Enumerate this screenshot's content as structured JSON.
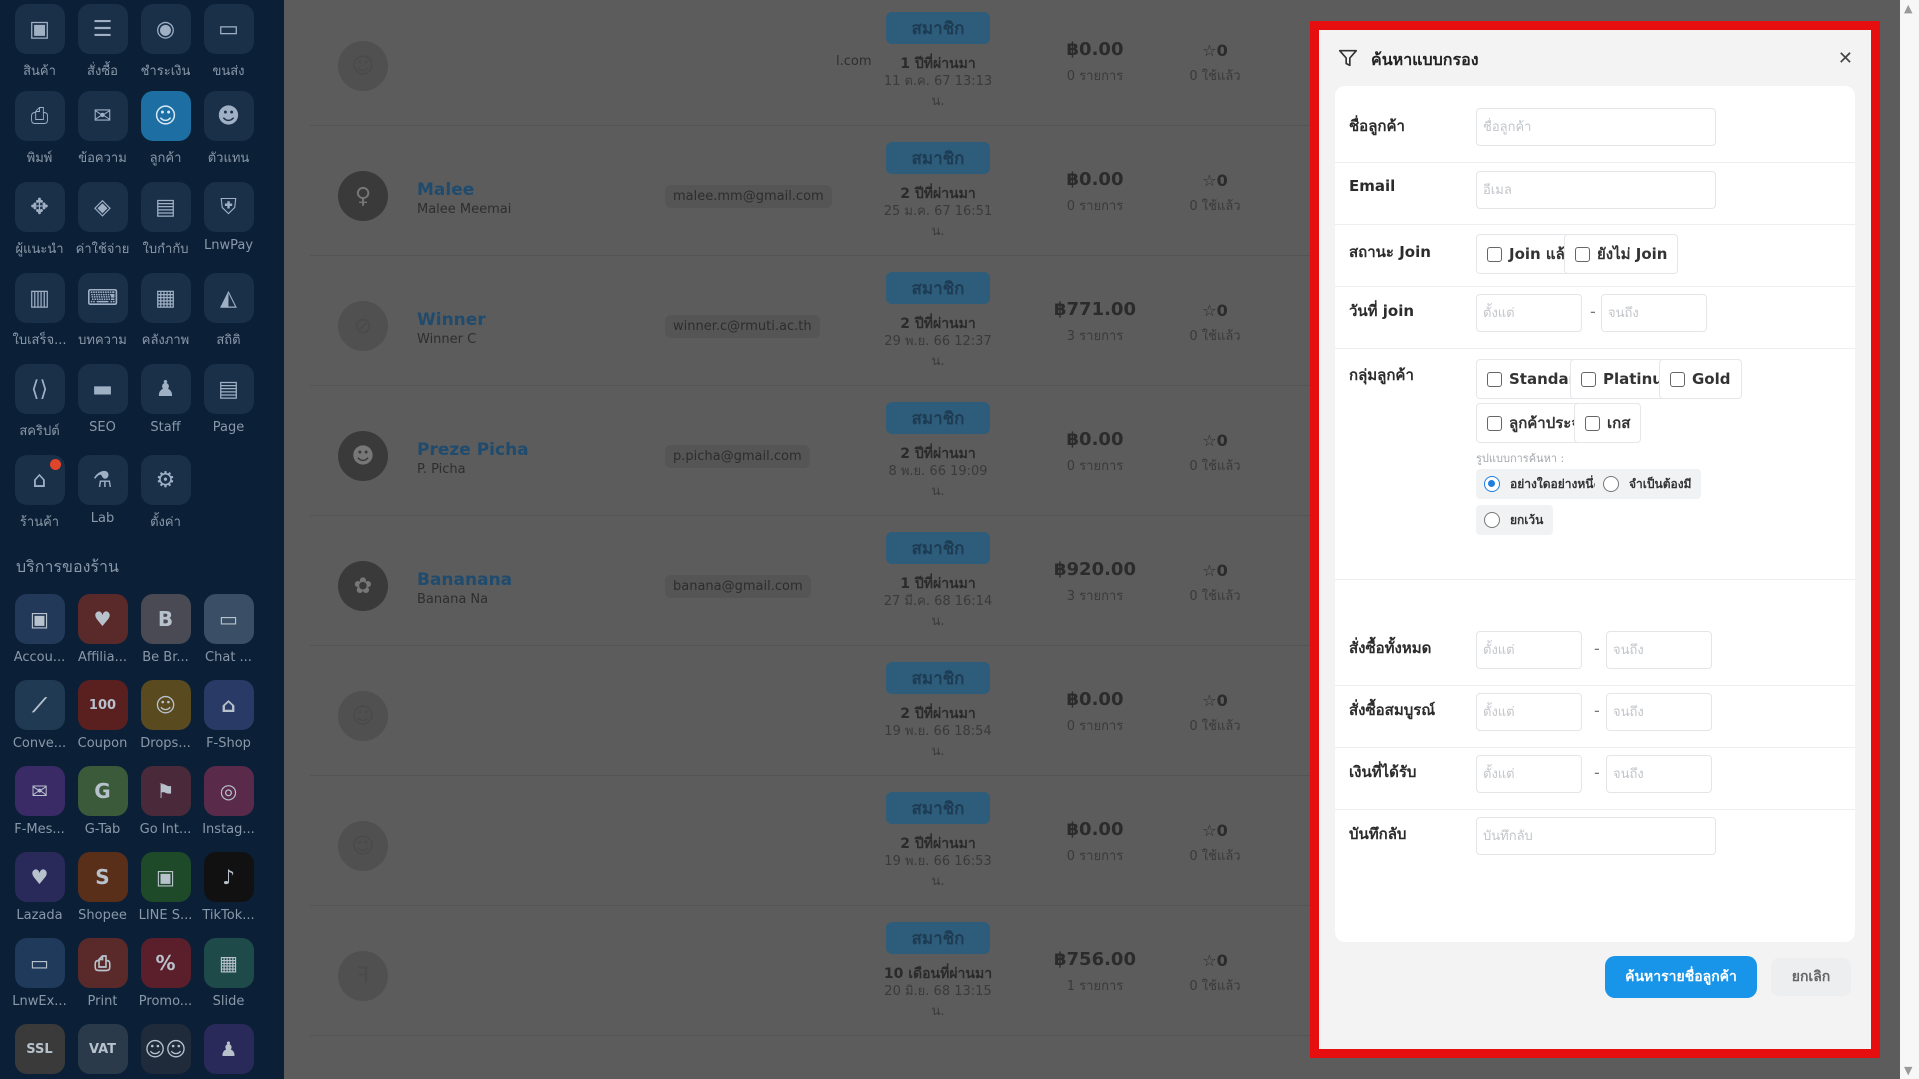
{
  "sidebar": {
    "apps": [
      {
        "label": "สินค้า",
        "icon": "product-box-icon",
        "glyph": "▣"
      },
      {
        "label": "สั่งซื้อ",
        "icon": "order-list-icon",
        "glyph": "☰"
      },
      {
        "label": "ชำระเงิน",
        "icon": "payment-piggy-icon",
        "glyph": "◉"
      },
      {
        "label": "ขนส่ง",
        "icon": "delivery-truck-icon",
        "glyph": "▭"
      },
      {
        "label": "พิมพ์",
        "icon": "printer-icon",
        "glyph": "⎙"
      },
      {
        "label": "ข้อความ",
        "icon": "mailbox-icon",
        "glyph": "✉"
      },
      {
        "label": "ลูกค้า",
        "icon": "customer-icon",
        "glyph": "☺",
        "active": true
      },
      {
        "label": "ตัวแทน",
        "icon": "agent-icon",
        "glyph": "☻"
      },
      {
        "label": "ผู้แนะนำ",
        "icon": "referrer-icon",
        "glyph": "✥"
      },
      {
        "label": "ค่าใช้จ่าย",
        "icon": "expense-bag-icon",
        "glyph": "◈"
      },
      {
        "label": "ใบกำกับ",
        "icon": "invoice-icon",
        "glyph": "▤"
      },
      {
        "label": "LnwPay",
        "icon": "shield-pay-icon",
        "glyph": "⛨"
      },
      {
        "label": "ใบเสร็จ...",
        "icon": "receipt-icon",
        "glyph": "▥"
      },
      {
        "label": "บทความ",
        "icon": "article-keyboard-icon",
        "glyph": "⌨"
      },
      {
        "label": "คลังภาพ",
        "icon": "image-gallery-icon",
        "glyph": "▦"
      },
      {
        "label": "สถิติ",
        "icon": "stats-chart-icon",
        "glyph": "◭"
      },
      {
        "label": "สคริปต์",
        "icon": "script-code-icon",
        "glyph": "⟨⟩"
      },
      {
        "label": "SEO",
        "icon": "seo-icon",
        "glyph": "▬"
      },
      {
        "label": "Staff",
        "icon": "staff-icon",
        "glyph": "♟"
      },
      {
        "label": "Page",
        "icon": "page-icon",
        "glyph": "▤"
      },
      {
        "label": "ร้านค้า",
        "icon": "shop-icon",
        "glyph": "⌂",
        "dot": true
      },
      {
        "label": "Lab",
        "icon": "lab-flask-icon",
        "glyph": "⚗"
      },
      {
        "label": "ตั้งค่า",
        "icon": "settings-gear-icon",
        "glyph": "⚙"
      }
    ],
    "services_title": "บริการของร้าน",
    "services": [
      {
        "label": "Accou...",
        "icon": "account-icon",
        "glyph": "▣",
        "color": "#23395a"
      },
      {
        "label": "Affilia...",
        "icon": "affiliate-icon",
        "glyph": "♥",
        "color": "#5a2a2a"
      },
      {
        "label": "Be Br...",
        "icon": "be-brand-icon",
        "glyph": "B",
        "color": "#4a4a55"
      },
      {
        "label": "Chat ...",
        "icon": "chat-icon",
        "glyph": "▭",
        "color": "#3a4f66"
      },
      {
        "label": "Conve...",
        "icon": "conversion-icon",
        "glyph": "⟋",
        "color": "#1f3a52"
      },
      {
        "label": "Coupon",
        "icon": "coupon-icon",
        "glyph": "100",
        "color": "#5a1f1f"
      },
      {
        "label": "Drops...",
        "icon": "dropship-icon",
        "glyph": "☺",
        "color": "#5a4a1f"
      },
      {
        "label": "F-Shop",
        "icon": "f-shop-icon",
        "glyph": "⌂",
        "color": "#2a3a66"
      },
      {
        "label": "F-Mes...",
        "icon": "messenger-icon",
        "glyph": "✉",
        "color": "#3a2a66"
      },
      {
        "label": "G-Tab",
        "icon": "g-tab-icon",
        "glyph": "G",
        "color": "#3a5a3a"
      },
      {
        "label": "Go Int...",
        "icon": "go-inter-icon",
        "glyph": "⚑",
        "color": "#4a2a3a"
      },
      {
        "label": "Instag...",
        "icon": "instagram-icon",
        "glyph": "◎",
        "color": "#5a2a4a"
      },
      {
        "label": "Lazada",
        "icon": "lazada-icon",
        "glyph": "♥",
        "color": "#2a2a5a"
      },
      {
        "label": "Shopee",
        "icon": "shopee-icon",
        "glyph": "S",
        "color": "#5a2f1a"
      },
      {
        "label": "LINE S...",
        "icon": "line-shop-icon",
        "glyph": "▣",
        "color": "#1f4a2a"
      },
      {
        "label": "TikTok...",
        "icon": "tiktok-icon",
        "glyph": "♪",
        "color": "#111111"
      },
      {
        "label": "LnwEx...",
        "icon": "lnw-express-icon",
        "glyph": "▭",
        "color": "#1f3a5a"
      },
      {
        "label": "Print",
        "icon": "print-service-icon",
        "glyph": "⎙",
        "color": "#5a2a2a"
      },
      {
        "label": "Promo...",
        "icon": "promotion-icon",
        "glyph": "%",
        "color": "#5a1f2a"
      },
      {
        "label": "Slide",
        "icon": "slide-icon",
        "glyph": "▦",
        "color": "#1f4a4a"
      },
      {
        "label": "SSL",
        "icon": "ssl-icon",
        "glyph": "SSL",
        "color": "#3a3a3a"
      },
      {
        "label": "",
        "icon": "vat-icon",
        "glyph": "VAT",
        "color": "#2a3a4a"
      },
      {
        "label": "",
        "icon": "team-icon",
        "glyph": "☺☺",
        "color": "#1f2a3a"
      },
      {
        "label": "",
        "icon": "staff-service-icon",
        "glyph": "♟",
        "color": "#2a2a5a"
      }
    ]
  },
  "customers": [
    {
      "name": "",
      "username": "",
      "email": "",
      "email_tail": "l.com",
      "badge": "สมาชิก",
      "relative": "1 ปีที่ผ่านมา",
      "date": "11 ต.ค. 67 13:13",
      "date_tail": "น.",
      "amount": "฿0.00",
      "orders": "0 รายการ",
      "points": "☆0",
      "used": "0 ใช้แล้ว",
      "avatar_glyph": "☺",
      "photo": false
    },
    {
      "name": "Malee",
      "username": "Malee Meemai",
      "email": "malee.mm@gmail.com",
      "email_tail": "",
      "badge": "สมาชิก",
      "relative": "2 ปีที่ผ่านมา",
      "date": "25 ม.ค. 67 16:51",
      "date_tail": "น.",
      "amount": "฿0.00",
      "orders": "0 รายการ",
      "points": "☆0",
      "used": "0 ใช้แล้ว",
      "avatar_glyph": "♀",
      "photo": true
    },
    {
      "name": "Winner",
      "username": "Winner C",
      "email": "winner.c@rmuti.ac.th",
      "email_tail": "",
      "badge": "สมาชิก",
      "relative": "2 ปีที่ผ่านมา",
      "date": "29 พ.ย. 66 12:37",
      "date_tail": "น.",
      "amount": "฿771.00",
      "orders": "3 รายการ",
      "points": "☆0",
      "used": "0 ใช้แล้ว",
      "avatar_glyph": "⊘",
      "photo": false
    },
    {
      "name": "Preze Picha",
      "username": "P. Picha",
      "email": "p.picha@gmail.com",
      "email_tail": "",
      "badge": "สมาชิก",
      "relative": "2 ปีที่ผ่านมา",
      "date": "8 พ.ย. 66 19:09",
      "date_tail": "น.",
      "amount": "฿0.00",
      "orders": "0 รายการ",
      "points": "☆0",
      "used": "0 ใช้แล้ว",
      "avatar_glyph": "☻",
      "photo": true
    },
    {
      "name": "Bananana",
      "username": "Banana Na",
      "email": "banana@gmail.com",
      "email_tail": "",
      "badge": "สมาชิก",
      "relative": "1 ปีที่ผ่านมา",
      "date": "27 มี.ค. 68 16:14",
      "date_tail": "น.",
      "amount": "฿920.00",
      "orders": "3 รายการ",
      "points": "☆0",
      "used": "0 ใช้แล้ว",
      "avatar_glyph": "✿",
      "photo": true
    },
    {
      "name": "",
      "username": "",
      "email": "",
      "email_tail": "",
      "badge": "สมาชิก",
      "relative": "2 ปีที่ผ่านมา",
      "date": "19 พ.ย. 66 18:54",
      "date_tail": "น.",
      "amount": "฿0.00",
      "orders": "0 รายการ",
      "points": "☆0",
      "used": "0 ใช้แล้ว",
      "avatar_glyph": "☺",
      "photo": false
    },
    {
      "name": "",
      "username": "",
      "email": "",
      "email_tail": "",
      "badge": "สมาชิก",
      "relative": "2 ปีที่ผ่านมา",
      "date": "19 พ.ย. 66 16:53",
      "date_tail": "น.",
      "amount": "฿0.00",
      "orders": "0 รายการ",
      "points": "☆0",
      "used": "0 ใช้แล้ว",
      "avatar_glyph": "☺",
      "photo": false
    },
    {
      "name": "",
      "username": "",
      "email": "",
      "email_tail": "",
      "badge": "สมาชิก",
      "relative": "10 เดือนที่ผ่านมา",
      "date": "20 มิ.ย. 68 13:15",
      "date_tail": "น.",
      "amount": "฿756.00",
      "orders": "1 รายการ",
      "points": "☆0",
      "used": "0 ใช้แล้ว",
      "avatar_glyph": "ꟻ",
      "photo": false
    }
  ],
  "filter": {
    "title": "ค้นหาแบบกรอง",
    "close": "✕",
    "customer_name": {
      "label": "ชื่อลูกค้า",
      "placeholder": "ชื่อลูกค้า",
      "value": ""
    },
    "email": {
      "label": "Email",
      "placeholder": "อีเมล",
      "value": ""
    },
    "join_status": {
      "label": "สถานะ Join",
      "options": [
        {
          "label": "Join แล้ว",
          "checked": false
        },
        {
          "label": "ยังไม่ Join",
          "checked": false
        }
      ]
    },
    "join_date": {
      "label": "วันที่ join",
      "from_placeholder": "ตั้งแต่",
      "to_placeholder": "จนถึง",
      "sep": "-"
    },
    "group": {
      "label": "กลุ่มลูกค้า",
      "options": [
        {
          "label": "Standard",
          "checked": false
        },
        {
          "label": "Platinum",
          "checked": false
        },
        {
          "label": "Gold",
          "checked": false
        },
        {
          "label": "ลูกค้าประจำ",
          "checked": false
        },
        {
          "label": "เกส",
          "checked": false
        }
      ],
      "mode_label": "รูปแบบการค้นหา :",
      "modes": [
        {
          "label": "อย่างใดอย่างหนึ่ง",
          "selected": true
        },
        {
          "label": "จำเป็นต้องมี",
          "selected": false
        },
        {
          "label": "ยกเว้น",
          "selected": false
        }
      ]
    },
    "total_orders": {
      "label": "สั่งซื้อทั้งหมด",
      "from_placeholder": "ตั้งแต่",
      "to_placeholder": "จนถึง",
      "sep": "-"
    },
    "completed_orders": {
      "label": "สั่งซื้อสมบูรณ์",
      "from_placeholder": "ตั้งแต่",
      "to_placeholder": "จนถึง",
      "sep": "-"
    },
    "money_received": {
      "label": "เงินที่ได้รับ",
      "from_placeholder": "ตั้งแต่",
      "to_placeholder": "จนถึง",
      "sep": "-"
    },
    "note": {
      "label": "บันทึกลับ",
      "placeholder": "บันทึกลับ",
      "value": ""
    },
    "search_button": "ค้นหารายชื่อลูกค้า",
    "cancel_button": "ยกเลิก"
  },
  "scrollbar": {
    "up": "▲",
    "down": "▼"
  }
}
